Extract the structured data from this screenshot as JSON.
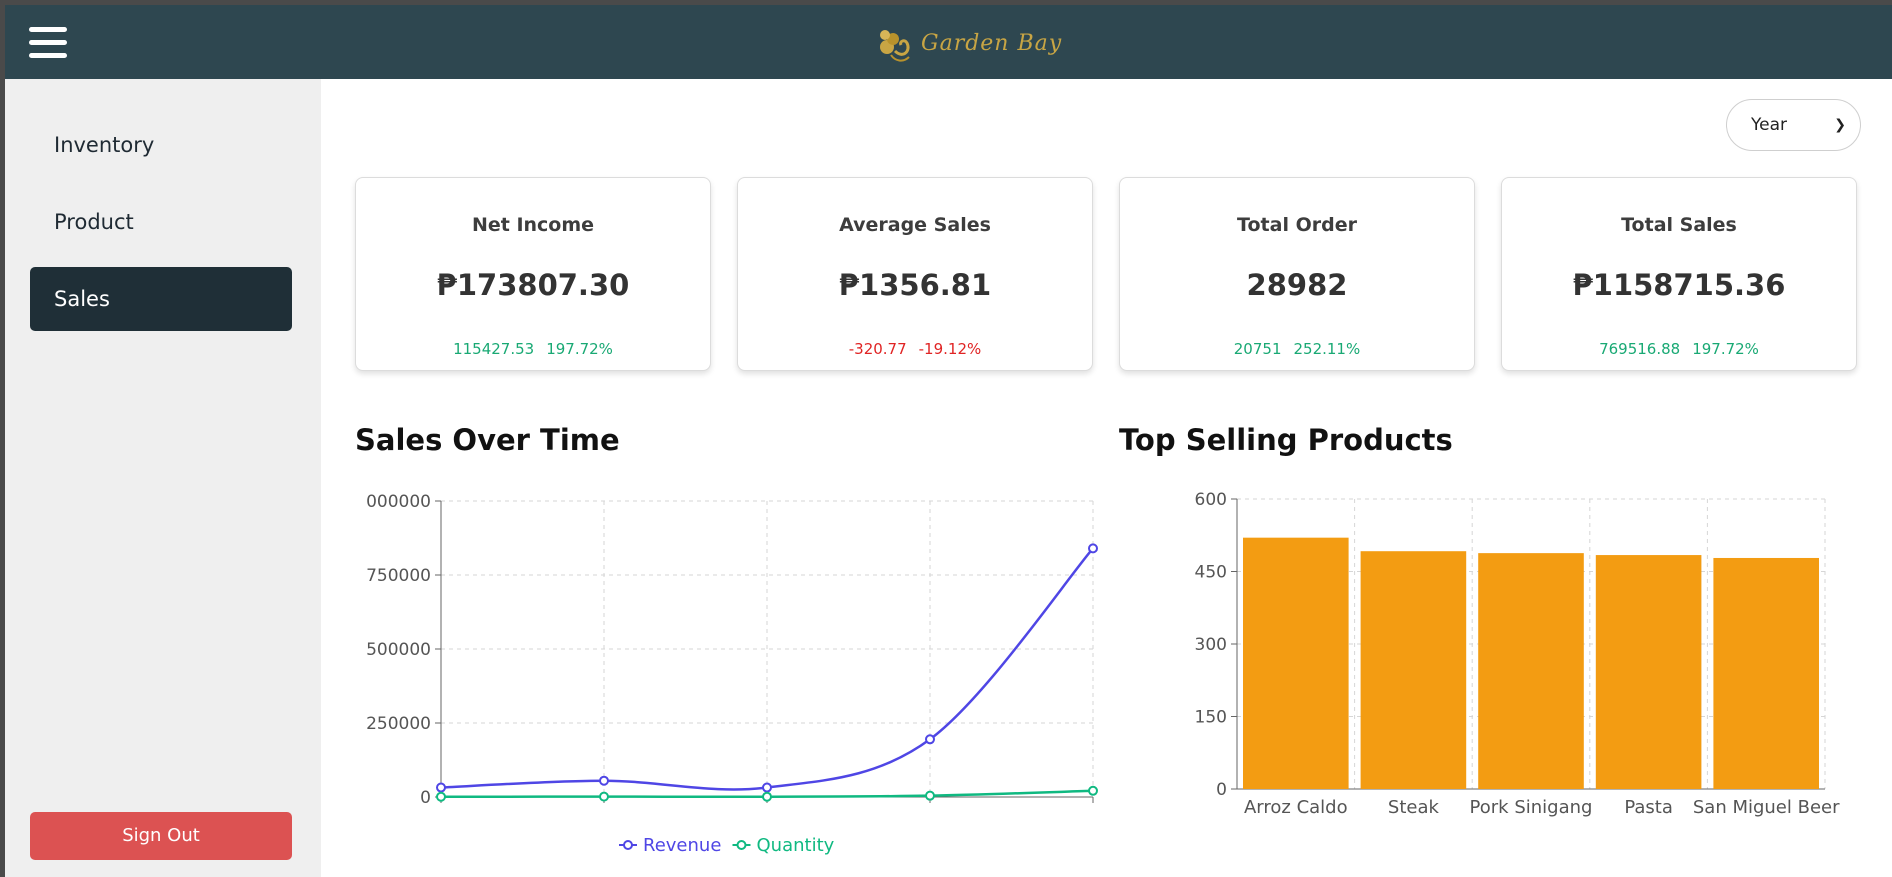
{
  "header": {
    "brand": "Garden Bay",
    "brand_color": "#c8a544",
    "bar_color": "#2e4750",
    "menu_icon": "hamburger-icon"
  },
  "sidebar": {
    "items": [
      {
        "label": "Inventory",
        "active": false
      },
      {
        "label": "Product",
        "active": false
      },
      {
        "label": "Sales",
        "active": true
      }
    ],
    "signout_label": "Sign Out"
  },
  "filters": {
    "period": "Year"
  },
  "cards": [
    {
      "title": "Net Income",
      "value": "₱173807.30",
      "delta": "115427.53",
      "delta_pct": "197.72%",
      "trend": "up"
    },
    {
      "title": "Average Sales",
      "value": "₱1356.81",
      "delta": "-320.77",
      "delta_pct": "-19.12%",
      "trend": "down"
    },
    {
      "title": "Total Order",
      "value": "28982",
      "delta": "20751",
      "delta_pct": "252.11%",
      "trend": "up"
    },
    {
      "title": "Total Sales",
      "value": "₱1158715.36",
      "delta": "769516.88",
      "delta_pct": "197.72%",
      "trend": "up"
    }
  ],
  "chart_data": [
    {
      "type": "line",
      "title": "Sales Over Time",
      "x": [
        "",
        "",
        "",
        "",
        ""
      ],
      "ylim": [
        0,
        1000000
      ],
      "yticks": [
        "000000",
        "750000",
        "500000",
        "250000",
        "0"
      ],
      "grid": true,
      "legend": "bottom",
      "series": [
        {
          "name": "Revenue",
          "color": "#4f46e5",
          "values": [
            32000,
            55000,
            32000,
            195000,
            840000
          ]
        },
        {
          "name": "Quantity",
          "color": "#10b981",
          "values": [
            800,
            1200,
            1000,
            4500,
            21000
          ]
        }
      ]
    },
    {
      "type": "bar",
      "title": "Top Selling Products",
      "categories": [
        "Arroz Caldo",
        "Steak",
        "Pork Sinigang",
        "Pasta",
        "San Miguel Beer"
      ],
      "values": [
        520,
        492,
        488,
        484,
        478
      ],
      "ylim": [
        0,
        600
      ],
      "yticks": [
        "600",
        "450",
        "300",
        "150",
        "0"
      ],
      "grid": true,
      "color": "#f39c12"
    }
  ]
}
